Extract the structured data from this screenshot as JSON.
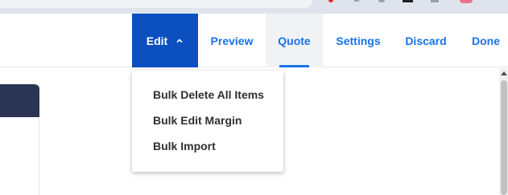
{
  "toolbar": {
    "tabs": {
      "edit": "Edit",
      "preview": "Preview",
      "quote": "Quote",
      "settings": "Settings",
      "discard": "Discard",
      "done": "Done"
    },
    "active_tab": "Edit",
    "selected_tab": "Quote"
  },
  "edit_menu": {
    "items": [
      "Bulk Delete All Items",
      "Bulk Edit Margin",
      "Bulk Import"
    ]
  },
  "colors": {
    "accent": "#1a73e8",
    "active_tab_bg": "#0b4fbf",
    "card_header": "#2b3452"
  },
  "icons": {
    "edit_chevron": "chevron-up-icon"
  }
}
